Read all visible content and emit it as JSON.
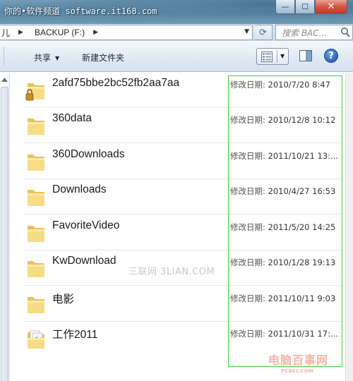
{
  "window": {
    "watermark_title": "你的•软件频道 software.it168.com",
    "min_glyph": "—",
    "max_glyph": "☐",
    "close_glyph": "✕"
  },
  "address": {
    "prefix": "儿",
    "path": "BACKUP (F:)",
    "separator": "▶",
    "dropdown": "▼",
    "refresh_glyph": "⟳",
    "search_placeholder": "搜索 BAC..."
  },
  "toolbar": {
    "share_label": "共享",
    "share_arrow": "▼",
    "newfolder_label": "新建文件夹",
    "view_arrow": "▼",
    "help_glyph": "?"
  },
  "files": [
    {
      "name": "2afd75bbe2bc52fb2aa7aa",
      "date_label": "修改日期:",
      "date": "2010/7/20 8:47",
      "icon": "locked-folder-icon"
    },
    {
      "name": "360data",
      "date_label": "修改日期:",
      "date": "2010/12/8 10:12",
      "icon": "folder-icon"
    },
    {
      "name": "360Downloads",
      "date_label": "修改日期:",
      "date": "2011/10/21 13:...",
      "icon": "folder-icon"
    },
    {
      "name": "Downloads",
      "date_label": "修改日期:",
      "date": "2010/4/27 16:53",
      "icon": "folder-icon"
    },
    {
      "name": "FavoriteVideo",
      "date_label": "修改日期:",
      "date": "2011/5/20 14:25",
      "icon": "folder-icon"
    },
    {
      "name": "KwDownload",
      "date_label": "修改日期:",
      "date": "2010/1/28 19:13",
      "icon": "folder-icon"
    },
    {
      "name": "电影",
      "date_label": "修改日期:",
      "date": "2011/10/11 9:03",
      "icon": "folder-icon"
    },
    {
      "name": "工作2011",
      "date_label": "修改日期:",
      "date": "2011/10/31 17:...",
      "icon": "documents-folder-icon"
    }
  ],
  "watermarks": {
    "center": "三联网 3LIAN.COM",
    "corner": "电脑百事网",
    "corner_sub": "PC841.COM"
  },
  "colors": {
    "highlight_box": "#3fcf3f",
    "folder_yellow": "#f1cf6a"
  }
}
